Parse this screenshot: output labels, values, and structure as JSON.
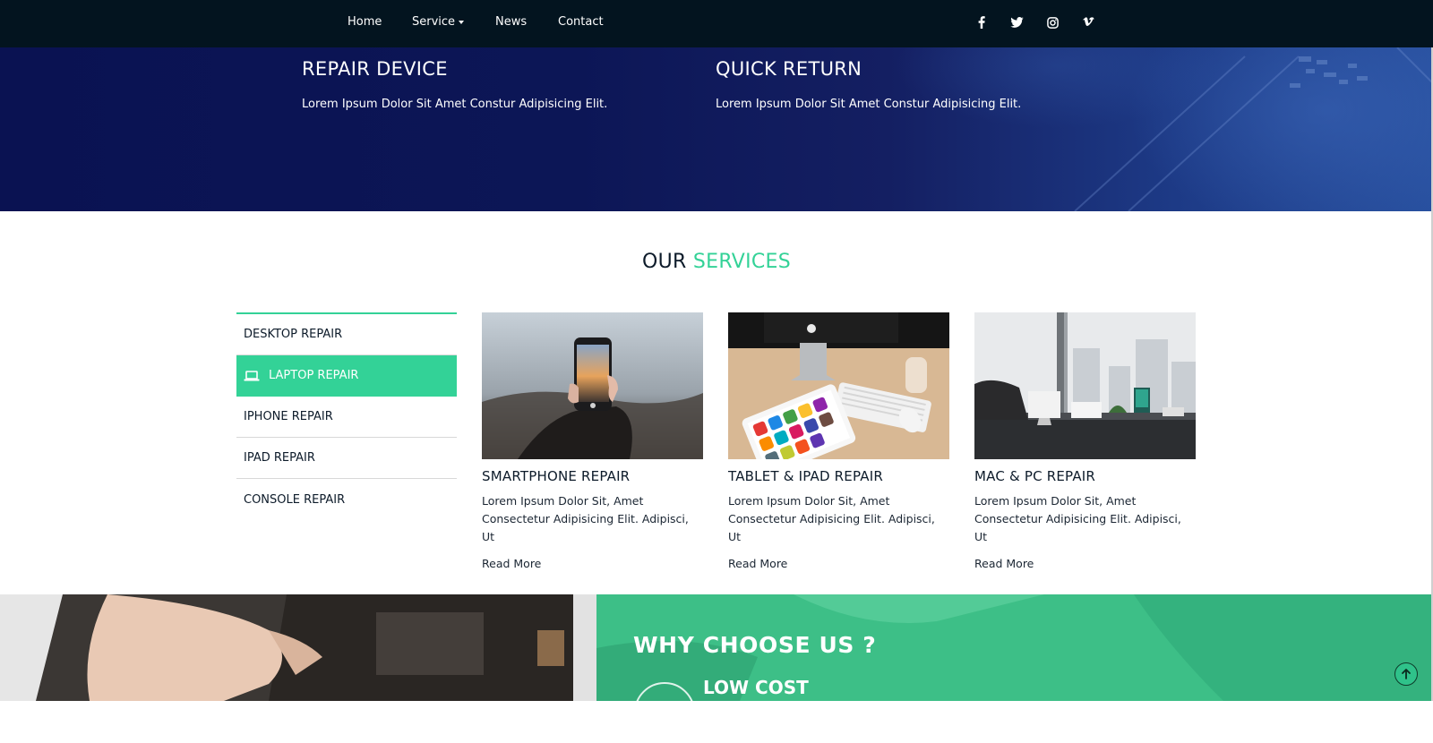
{
  "nav": {
    "links": [
      {
        "label": "Home"
      },
      {
        "label": "Service"
      },
      {
        "label": "News"
      },
      {
        "label": "Contact"
      }
    ],
    "social_icons": [
      "facebook-icon",
      "twitter-icon",
      "instagram-icon",
      "vimeo-icon"
    ]
  },
  "hero": {
    "features": [
      {
        "title": "REPAIR DEVICE",
        "text": "Lorem Ipsum Dolor Sit Amet Constur Adipisicing Elit."
      },
      {
        "title": "QUICK RETURN",
        "text": "Lorem Ipsum Dolor Sit Amet Constur Adipisicing Elit."
      }
    ]
  },
  "services": {
    "heading_prefix": "OUR",
    "heading_accent": "SERVICES",
    "tabs": [
      {
        "label": "DESKTOP REPAIR",
        "active": false
      },
      {
        "label": "LAPTOP REPAIR",
        "active": true,
        "icon": "laptop-icon"
      },
      {
        "label": "IPHONE REPAIR",
        "active": false
      },
      {
        "label": "IPAD REPAIR",
        "active": false
      },
      {
        "label": "CONSOLE REPAIR",
        "active": false
      }
    ],
    "cards": [
      {
        "title": "SMARTPHONE REPAIR",
        "desc": "Lorem Ipsum Dolor Sit, Amet Consectetur Adipisicing Elit. Adipisci, Ut",
        "more": "Read More"
      },
      {
        "title": "TABLET & IPAD REPAIR",
        "desc": "Lorem Ipsum Dolor Sit, Amet Consectetur Adipisicing Elit. Adipisci, Ut",
        "more": "Read More"
      },
      {
        "title": "MAC & PC REPAIR",
        "desc": "Lorem Ipsum Dolor Sit, Amet Consectetur Adipisicing Elit. Adipisci, Ut",
        "more": "Read More"
      }
    ]
  },
  "why": {
    "title": "WHY CHOOSE US ?",
    "item1": "LOW COST"
  },
  "colors": {
    "nav_bg": "#03141f",
    "hero_bg": "#0c1656",
    "accent": "#33d297",
    "text_dark": "#0d1b2a"
  }
}
